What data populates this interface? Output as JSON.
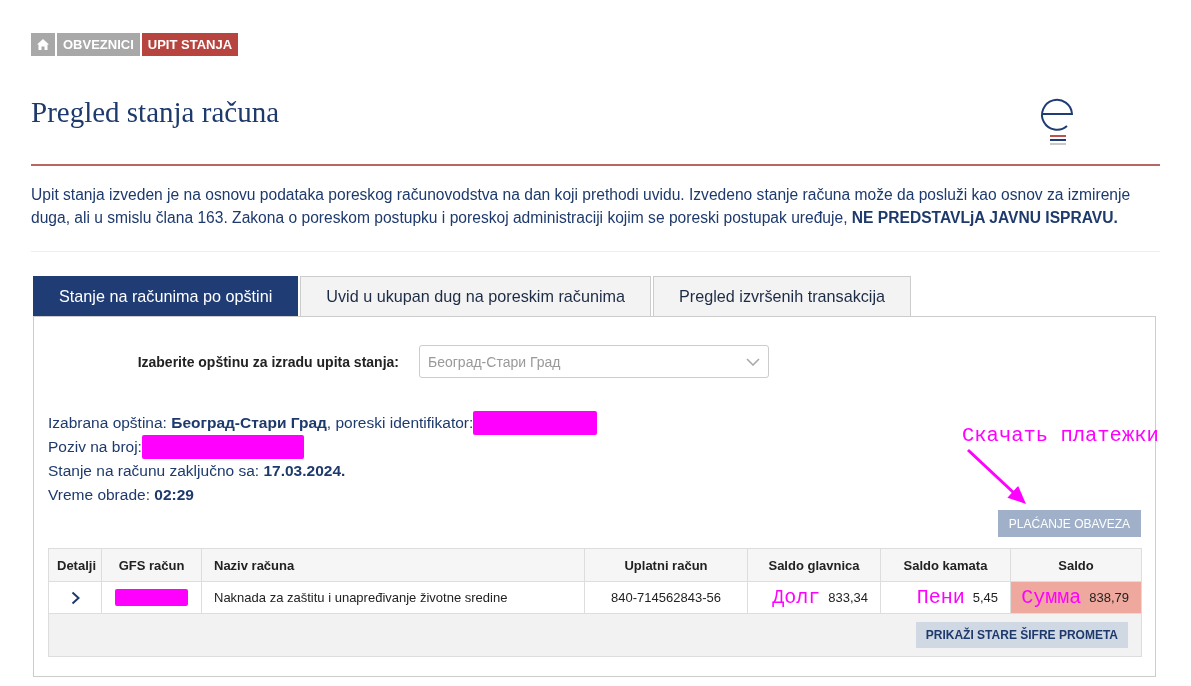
{
  "breadcrumb": [
    {
      "kind": "home",
      "current": false
    },
    {
      "kind": "link",
      "label": "OBVEZNICI",
      "current": false
    },
    {
      "kind": "link",
      "label": "UPIT STANJA",
      "current": true
    }
  ],
  "page_title": "Pregled stanja računa",
  "notice": "Upit stanja izveden je na osnovu podataka poreskog računovodstva na dan koji prethodi uvidu. Izvedeno stanje računa može da posluži kao osnov za izmirenje duga, ali u smislu člana 163. Zakona o poreskom postupku i poreskoj administraciji kojim se poreski postupak uređuje, **NE PREDSTAVLjA JAVNU ISPRAVU.**",
  "tabs": [
    {
      "label": "Stanje na računima po opštini",
      "selected": true
    },
    {
      "label": "Uvid u ukupan dug na poreskim računima",
      "selected": false
    },
    {
      "label": "Pregled izvršenih transakcija",
      "selected": false
    }
  ],
  "municipality_select": {
    "label": "Izaberite opštinu za izradu upita stanja:",
    "value": "Београд-Стари Град"
  },
  "info_lines": [
    {
      "text": "Izabrana opština: **Београд-Стари Град**, poreski identifikator:",
      "redacted": true
    },
    {
      "text": "Poziv na broj:",
      "redacted": true
    },
    {
      "text": "Stanje na računu zaključno sa: **17.03.2024.**",
      "redacted": false
    },
    {
      "text": "Vreme obrade: **02:29**",
      "redacted": false
    }
  ],
  "download_annotation": "Скачать платежки",
  "pay_button": "PLAĆANJE OBAVEZA",
  "table": {
    "columns": [
      "Detalji",
      "GFS račun",
      "Naziv računa",
      "Uplatni račun",
      "Saldo glavnica",
      "Saldo kamata",
      "Saldo"
    ],
    "rows": [
      {
        "expanded": false,
        "gfs_redacted": true,
        "name": "Naknada za zaštitu i unapređivanje životne sredine",
        "account": "840-714562843-56",
        "principal": {
          "note": "Долг",
          "value": "833,34",
          "highlighted": false
        },
        "interest": {
          "note": "Пени",
          "value": "5,45",
          "highlighted": false
        },
        "balance": {
          "note": "Сумма",
          "value": "838,79",
          "highlighted": true
        }
      }
    ]
  },
  "old_codes_button": "PRIKAŽI STARE ŠIFRE PROMETA"
}
